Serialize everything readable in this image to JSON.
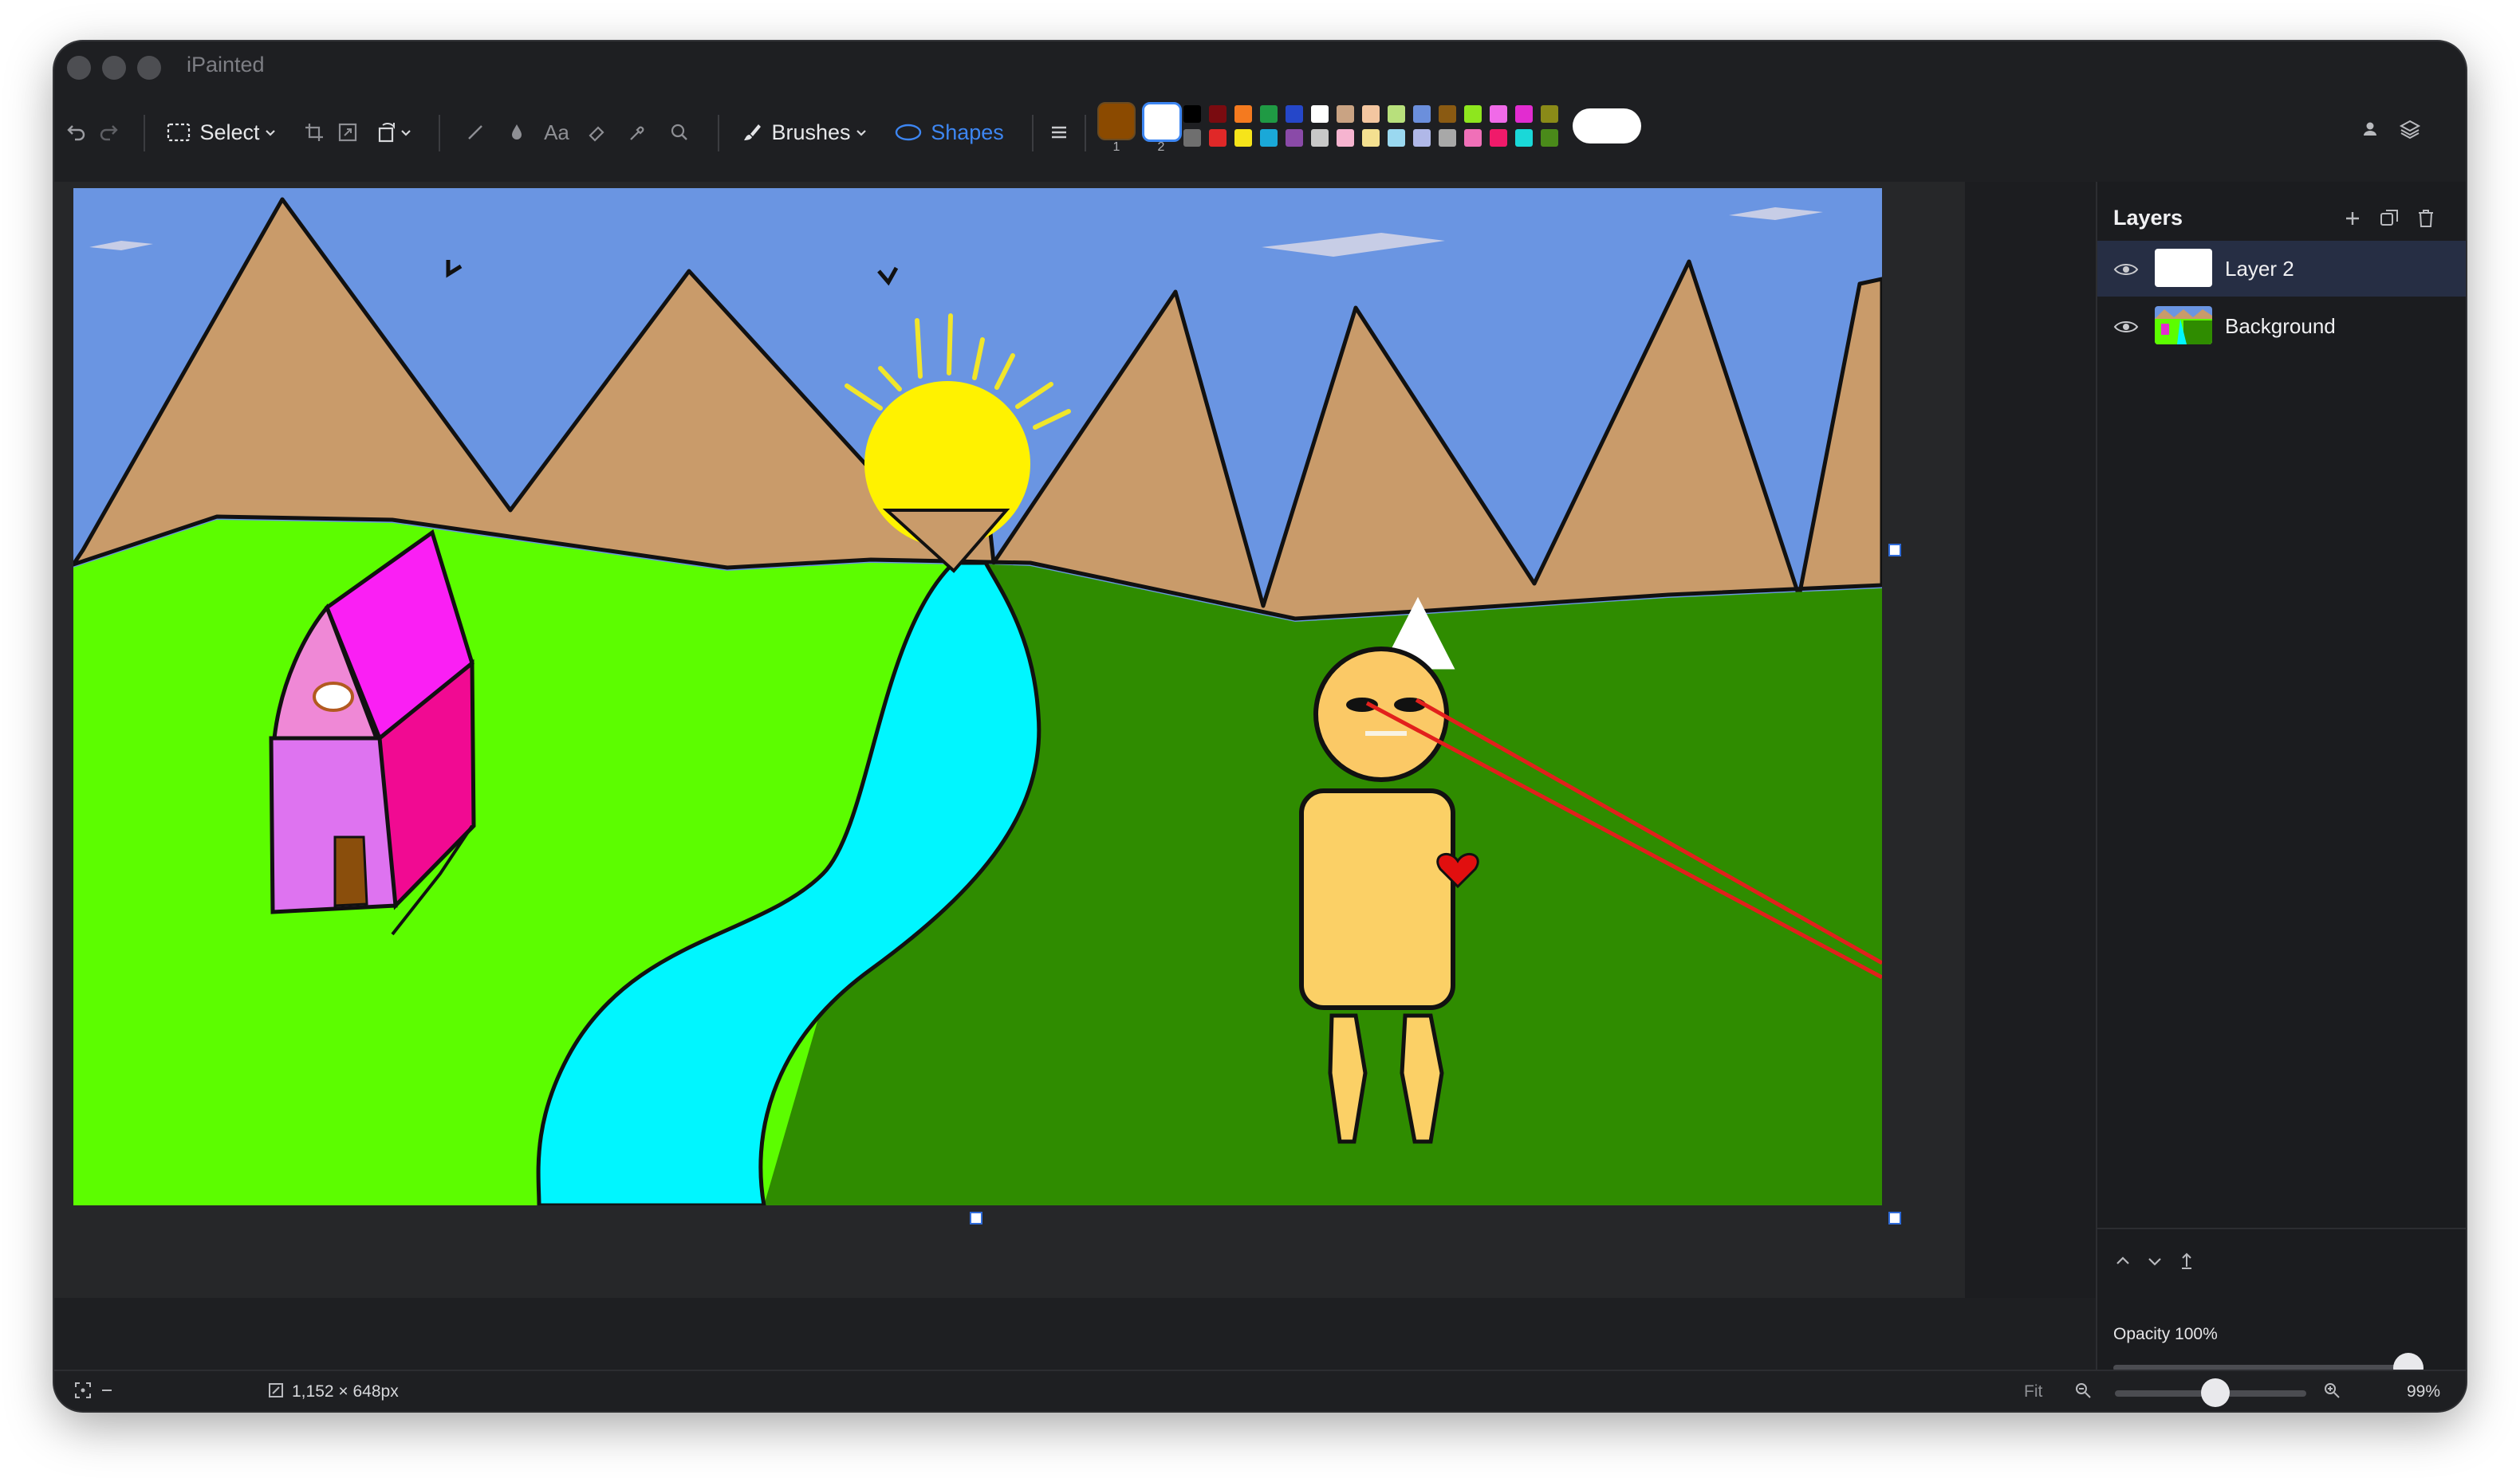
{
  "app": {
    "title": "iPainted"
  },
  "toolbar": {
    "select_label": "Select",
    "brushes_label": "Brushes",
    "shapes_label": "Shapes",
    "swatch1_number": "1",
    "swatch2_number": "2",
    "primary_color": "#8b4a00",
    "secondary_color": "#ffffff",
    "palette_top": [
      "#000000",
      "#7a0b10",
      "#f47a1f",
      "#1f9a44",
      "#2547c9",
      "#ffffff",
      "#c9a383",
      "#f3c6a0",
      "#b8e07c",
      "#6b8fdc",
      "#8a5a12",
      "#8ee61e",
      "#f06ae8",
      "#e22cd0",
      "#8a8a18"
    ],
    "palette_bottom": [
      "#6f6f6f",
      "#e02828",
      "#f6e41a",
      "#1aa8d8",
      "#8a4aa8",
      "#c8c8c8",
      "#f6b4d0",
      "#f4e090",
      "#9ad8f0",
      "#b0b8e8",
      "#a8a8a8",
      "#f070b8",
      "#f01a6a",
      "#1ad8d8",
      "#4a8a1a"
    ]
  },
  "layers_panel": {
    "title": "Layers",
    "layers": [
      {
        "name": "Layer 2",
        "selected": true
      },
      {
        "name": "Background",
        "selected": false
      }
    ],
    "opacity_label": "Opacity 100%",
    "opacity_value": 1.0
  },
  "statusbar": {
    "canvas_size": "1,152 × 648px",
    "fit_label": "Fit",
    "zoom_label": "99%",
    "zoom_value": 0.99
  }
}
